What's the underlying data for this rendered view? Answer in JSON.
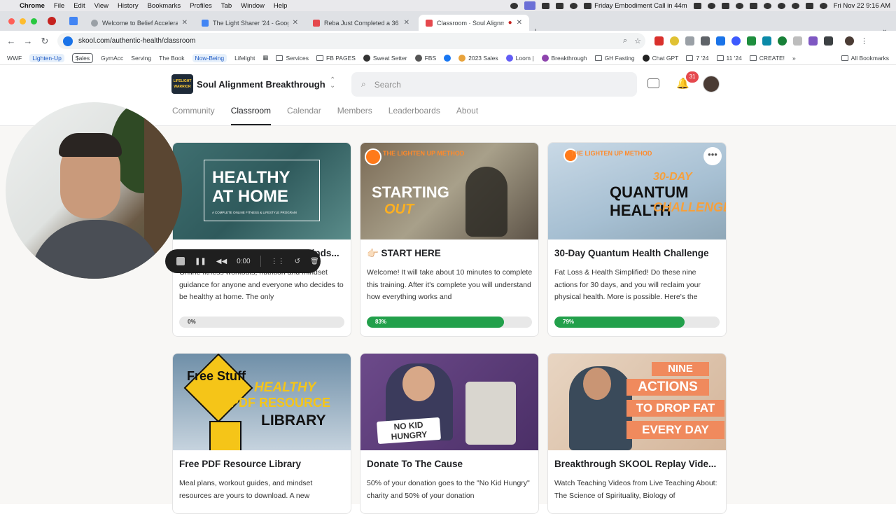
{
  "menubar": {
    "app": "Chrome",
    "items": [
      "File",
      "Edit",
      "View",
      "History",
      "Bookmarks",
      "Profiles",
      "Tab",
      "Window",
      "Help"
    ],
    "event": "Friday Embodiment Call in 44m",
    "datetime": "Fri Nov 22  9:16 AM"
  },
  "tabs": [
    {
      "title": "Welcome to Belief Accelerato",
      "active": false
    },
    {
      "title": "The Light Sharer '24 - Googl",
      "active": false
    },
    {
      "title": "Reba Just Completed a 36 Ho",
      "active": false
    },
    {
      "title": "Classroom · Soul Alignme",
      "active": true
    }
  ],
  "toolbar": {
    "url": "skool.com/authentic-health/classroom"
  },
  "bookmarks": [
    {
      "label": "WWF",
      "style": "plain"
    },
    {
      "label": "Lighten-Up",
      "style": "blue"
    },
    {
      "label": "$ales",
      "style": "box"
    },
    {
      "label": "GymAcc",
      "style": "plain"
    },
    {
      "label": "Serving",
      "style": "plain"
    },
    {
      "label": "The Book",
      "style": "plain"
    },
    {
      "label": "Now-Being",
      "style": "blue"
    },
    {
      "label": "Lifelight",
      "style": "plain"
    },
    {
      "label": "Services",
      "style": "folder"
    },
    {
      "label": "FB PAGES",
      "style": "folder"
    },
    {
      "label": "Sweat Setter",
      "style": "icon"
    },
    {
      "label": "FBS",
      "style": "icon"
    },
    {
      "label": "2023 Sales",
      "style": "icon"
    },
    {
      "label": "Loom |",
      "style": "icon"
    },
    {
      "label": "Breakthrough",
      "style": "icon"
    },
    {
      "label": "GH Fasting",
      "style": "folder"
    },
    {
      "label": "Chat GPT",
      "style": "icon"
    },
    {
      "label": "7 '24",
      "style": "folder"
    },
    {
      "label": "11 '24",
      "style": "folder"
    },
    {
      "label": "CREATE!",
      "style": "folder"
    }
  ],
  "all_bookmarks": "All Bookmarks",
  "header": {
    "logo_text": "LIFELIGHT WARRIOR",
    "group_name": "Soul Alignment Breakthrough",
    "search_placeholder": "Search",
    "notification_count": "31"
  },
  "nav": [
    "Community",
    "Classroom",
    "Calendar",
    "Members",
    "Leaderboards",
    "About"
  ],
  "nav_active": "Classroom",
  "cards": [
    {
      "title": "Healthy At Home (Fitness + Minds...",
      "desc": "Online fitness workouts, nutrition and mindset guidance for anyone and everyone who decides to be healthy at home. The only",
      "progress_label": "0%",
      "progress": 0,
      "thumb": {
        "line1": "HEALTHY",
        "line2": "AT HOME",
        "sub": "A COMPLETE ONLINE FITNESS & LIFESTYLE PROGRAM"
      }
    },
    {
      "title": "👉🏻 START HERE",
      "desc": "Welcome! It will take about 10 minutes to complete this training. After it's complete you will understand how everything works and",
      "progress_label": "83%",
      "progress": 0.83,
      "thumb": {
        "brand": "THE LIGHTEN UP METHOD",
        "line1": "STARTING",
        "line2": "OUT"
      }
    },
    {
      "title": "30-Day Quantum Health Challenge",
      "desc": "Fat Loss & Health Simplified! Do these nine actions for 30 days, and you will reclaim your physical health. More is possible. Here's the",
      "progress_label": "79%",
      "progress": 0.79,
      "thumb": {
        "brand": "THE LIGHTEN UP METHOD",
        "line0": "30-DAY",
        "line1": "QUANTUM HEALTH",
        "line2": "CHALLENGE",
        "more": "•••"
      }
    },
    {
      "title": "Free PDF Resource Library",
      "desc": "Meal plans, workout guides, and mindset resources are yours to download. A new",
      "thumb": {
        "sign": "Free Stuff",
        "line1": "HEALTHY",
        "line2": "PDF RESOURCE",
        "line3": "LIBRARY"
      }
    },
    {
      "title": "Donate To The Cause",
      "desc": "50% of your donation goes to the \"No Kid Hungry\" charity and 50% of your donation",
      "thumb": {
        "badge": "NO KID HUNGRY"
      }
    },
    {
      "title": "Breakthrough SKOOL Replay Vide...",
      "desc": "Watch Teaching Videos from Live Teaching About: The Science of Spirituality, Biology of",
      "thumb": {
        "l1": "NINE",
        "l2": "ACTIONS",
        "l3": "TO DROP FAT",
        "l4": "EVERY DAY"
      }
    }
  ],
  "recorder": {
    "time": "0:00"
  },
  "colors": {
    "progress_fill": "#22a04b",
    "accent": "#202124",
    "notification": "#e5484d"
  }
}
